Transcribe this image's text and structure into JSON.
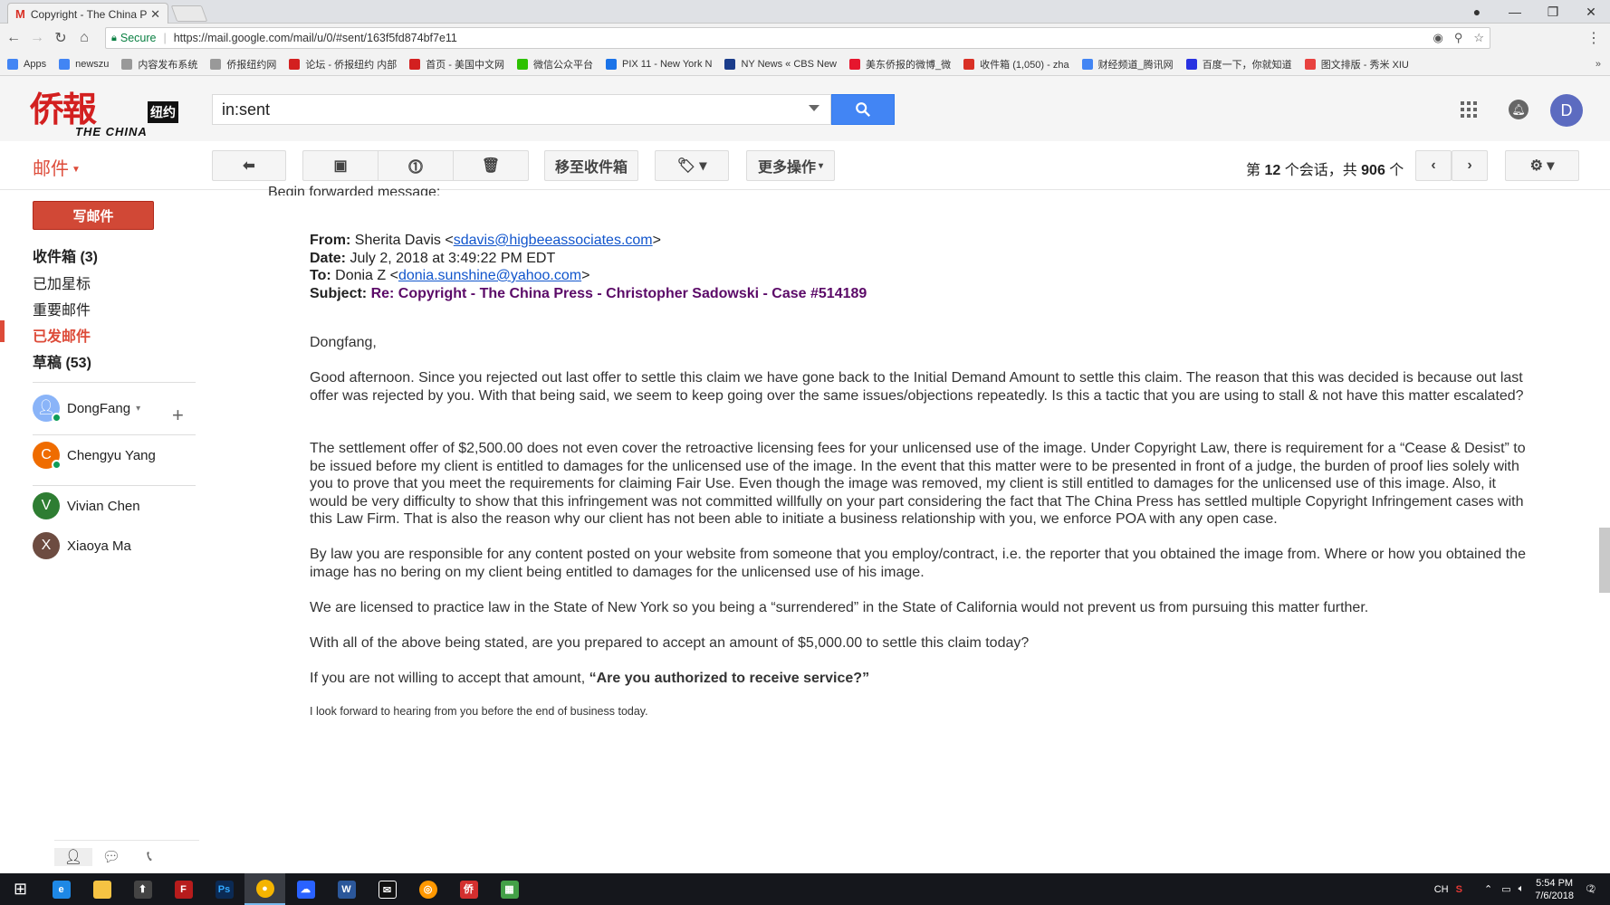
{
  "browser": {
    "tab_title": "Copyright - The China Pr",
    "tab_icon": "M",
    "secure_label": "Secure",
    "url": "https://mail.google.com/mail/u/0/#sent/163f5fd874bf7e11",
    "bookmarks": [
      {
        "label": "Apps",
        "color": "#4285f4"
      },
      {
        "label": "newszu",
        "color": "#4285f4"
      },
      {
        "label": "内容发布系统",
        "color": "#999999"
      },
      {
        "label": "侨报纽约网",
        "color": "#999999"
      },
      {
        "label": "论坛 - 侨报纽约 内部",
        "color": "#d32020"
      },
      {
        "label": "首页 - 美国中文网",
        "color": "#d32020"
      },
      {
        "label": "微信公众平台",
        "color": "#2dc100"
      },
      {
        "label": "PIX 11 - New York N",
        "color": "#1a73e8"
      },
      {
        "label": "NY News « CBS New",
        "color": "#1a3c8b"
      },
      {
        "label": "美东侨报的微博_微",
        "color": "#e6162d"
      },
      {
        "label": "收件箱 (1,050) - zha",
        "color": "#d93025"
      },
      {
        "label": "财经频道_腾讯网",
        "color": "#4285f4"
      },
      {
        "label": "百度一下，你就知道",
        "color": "#2932e1"
      },
      {
        "label": "图文排版 - 秀米 XIU",
        "color": "#e8423f"
      }
    ]
  },
  "gmail": {
    "logo_chinese": "侨報",
    "logo_nyc": "纽约",
    "logo_english": "THE CHINA PRESS",
    "search_value": "in:sent",
    "avatar_letter": "D",
    "mail_label": "邮件",
    "toolbar": {
      "move_to_inbox": "移至收件箱",
      "more_actions": "更多操作",
      "page_prefix": "第 ",
      "page_current": "12",
      "page_middle": " 个会话，共 ",
      "page_total": "906",
      "page_suffix": " 个"
    },
    "compose_label": "写邮件",
    "nav": {
      "inbox": "收件箱 (3)",
      "starred": "已加星标",
      "important": "重要邮件",
      "sent": "已发邮件",
      "drafts": "草稿 (53)"
    },
    "contacts": [
      {
        "name": "DongFang",
        "initial": "",
        "color": "#8ab4f8"
      },
      {
        "name": "Chengyu Yang",
        "initial": "C",
        "color": "#ef6c00"
      },
      {
        "name": "Vivian Chen",
        "initial": "V",
        "color": "#2e7d32"
      },
      {
        "name": "Xiaoya Ma",
        "initial": "X",
        "color": "#6d4c41"
      }
    ]
  },
  "email": {
    "begin_line": "Begin forwarded message:",
    "from_label": "From:",
    "from_name": "Sherita Davis <",
    "from_email": "sdavis@higbeeassociates.com",
    "date_label": "Date:",
    "date_value": "July 2, 2018 at 3:49:22 PM EDT",
    "to_label": "To:",
    "to_name": "Donia Z <",
    "to_email": "donia.sunshine@yahoo.com",
    "subject_label": "Subject:",
    "subject_value": "Re: Copyright - The China Press - Christopher Sadowski - Case #514189",
    "greeting": "Dongfang,",
    "p1": "Good afternoon. Since you rejected out last offer to settle this claim we have gone back to the Initial Demand Amount to settle this claim. The reason that this was decided is because out last offer was rejected by you. With that being said, we seem to keep going over the same issues/objections repeatedly. Is this a tactic that you are using to stall & not have this matter escalated?",
    "p2": "The settlement offer of $2,500.00 does not even cover the retroactive licensing fees for your unlicensed use of the image. Under Copyright Law, there is requirement for a “Cease & Desist” to be issued before my client is entitled to damages for the unlicensed use of the image. In the event that this matter were to be presented in front of a judge, the burden of proof lies solely with you to prove that you meet the requirements for claiming Fair Use. Even though the image was removed, my client is still entitled to damages for the unlicensed use of this image. Also, it would be very difficulty to show that this infringement was not committed willfully on your part considering the fact that The China Press has settled multiple Copyright Infringement cases with this Law Firm. That is also the reason why our client has not been able to initiate a business relationship with you, we enforce POA with any open case.",
    "p3": "By law you are responsible for any content posted on your website from someone that you employ/contract, i.e. the reporter that you obtained the image from. Where or how you obtained the image has no bering on my client being entitled to damages for the unlicensed use of his image.",
    "p4": "We are licensed to practice law in the State of New York so you being a “surrendered” in the State of California would not prevent us from pursuing this matter further.",
    "p5": "With all of the above being stated, are you prepared to accept an amount of $5,000.00 to settle this claim today?",
    "p6_lead": "If you are not willing to accept that amount, ",
    "p6_bold": "“Are you authorized to receive service?”",
    "p7": "I look forward to hearing from you before the end of business today."
  },
  "taskbar": {
    "lang": "CH",
    "time": "5:54 PM",
    "date": "7/6/2018",
    "notif_count": "2"
  }
}
